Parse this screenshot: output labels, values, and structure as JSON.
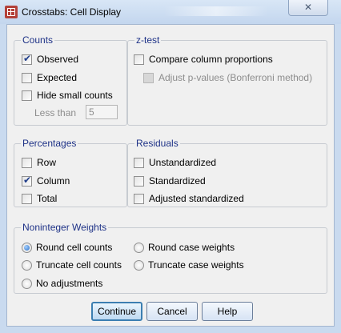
{
  "window": {
    "title": "Crosstabs: Cell Display",
    "close_symbol": "✕"
  },
  "counts": {
    "legend": "Counts",
    "observed": {
      "label": "Observed",
      "checked": true
    },
    "expected": {
      "label": "Expected",
      "checked": false
    },
    "hide_small": {
      "label": "Hide small counts",
      "checked": false
    },
    "less_than_label": "Less than",
    "less_than_value": "5"
  },
  "ztest": {
    "legend": "z-test",
    "compare": {
      "label": "Compare column proportions",
      "checked": false
    },
    "adjust": {
      "label": "Adjust p-values (Bonferroni method)",
      "checked": false,
      "disabled": true
    }
  },
  "percentages": {
    "legend": "Percentages",
    "row": {
      "label": "Row",
      "checked": false
    },
    "column": {
      "label": "Column",
      "checked": true
    },
    "total": {
      "label": "Total",
      "checked": false
    }
  },
  "residuals": {
    "legend": "Residuals",
    "unstandardized": {
      "label": "Unstandardized",
      "checked": false
    },
    "standardized": {
      "label": "Standardized",
      "checked": false
    },
    "adjusted": {
      "label": "Adjusted standardized",
      "checked": false
    }
  },
  "weights": {
    "legend": "Noninteger Weights",
    "round_cell": {
      "label": "Round cell counts",
      "selected": true
    },
    "round_case": {
      "label": "Round case weights",
      "selected": false
    },
    "truncate_cell": {
      "label": "Truncate cell counts",
      "selected": false
    },
    "truncate_case": {
      "label": "Truncate case weights",
      "selected": false
    },
    "no_adjust": {
      "label": "No adjustments",
      "selected": false
    }
  },
  "buttons": {
    "continue": "Continue",
    "cancel": "Cancel",
    "help": "Help"
  }
}
